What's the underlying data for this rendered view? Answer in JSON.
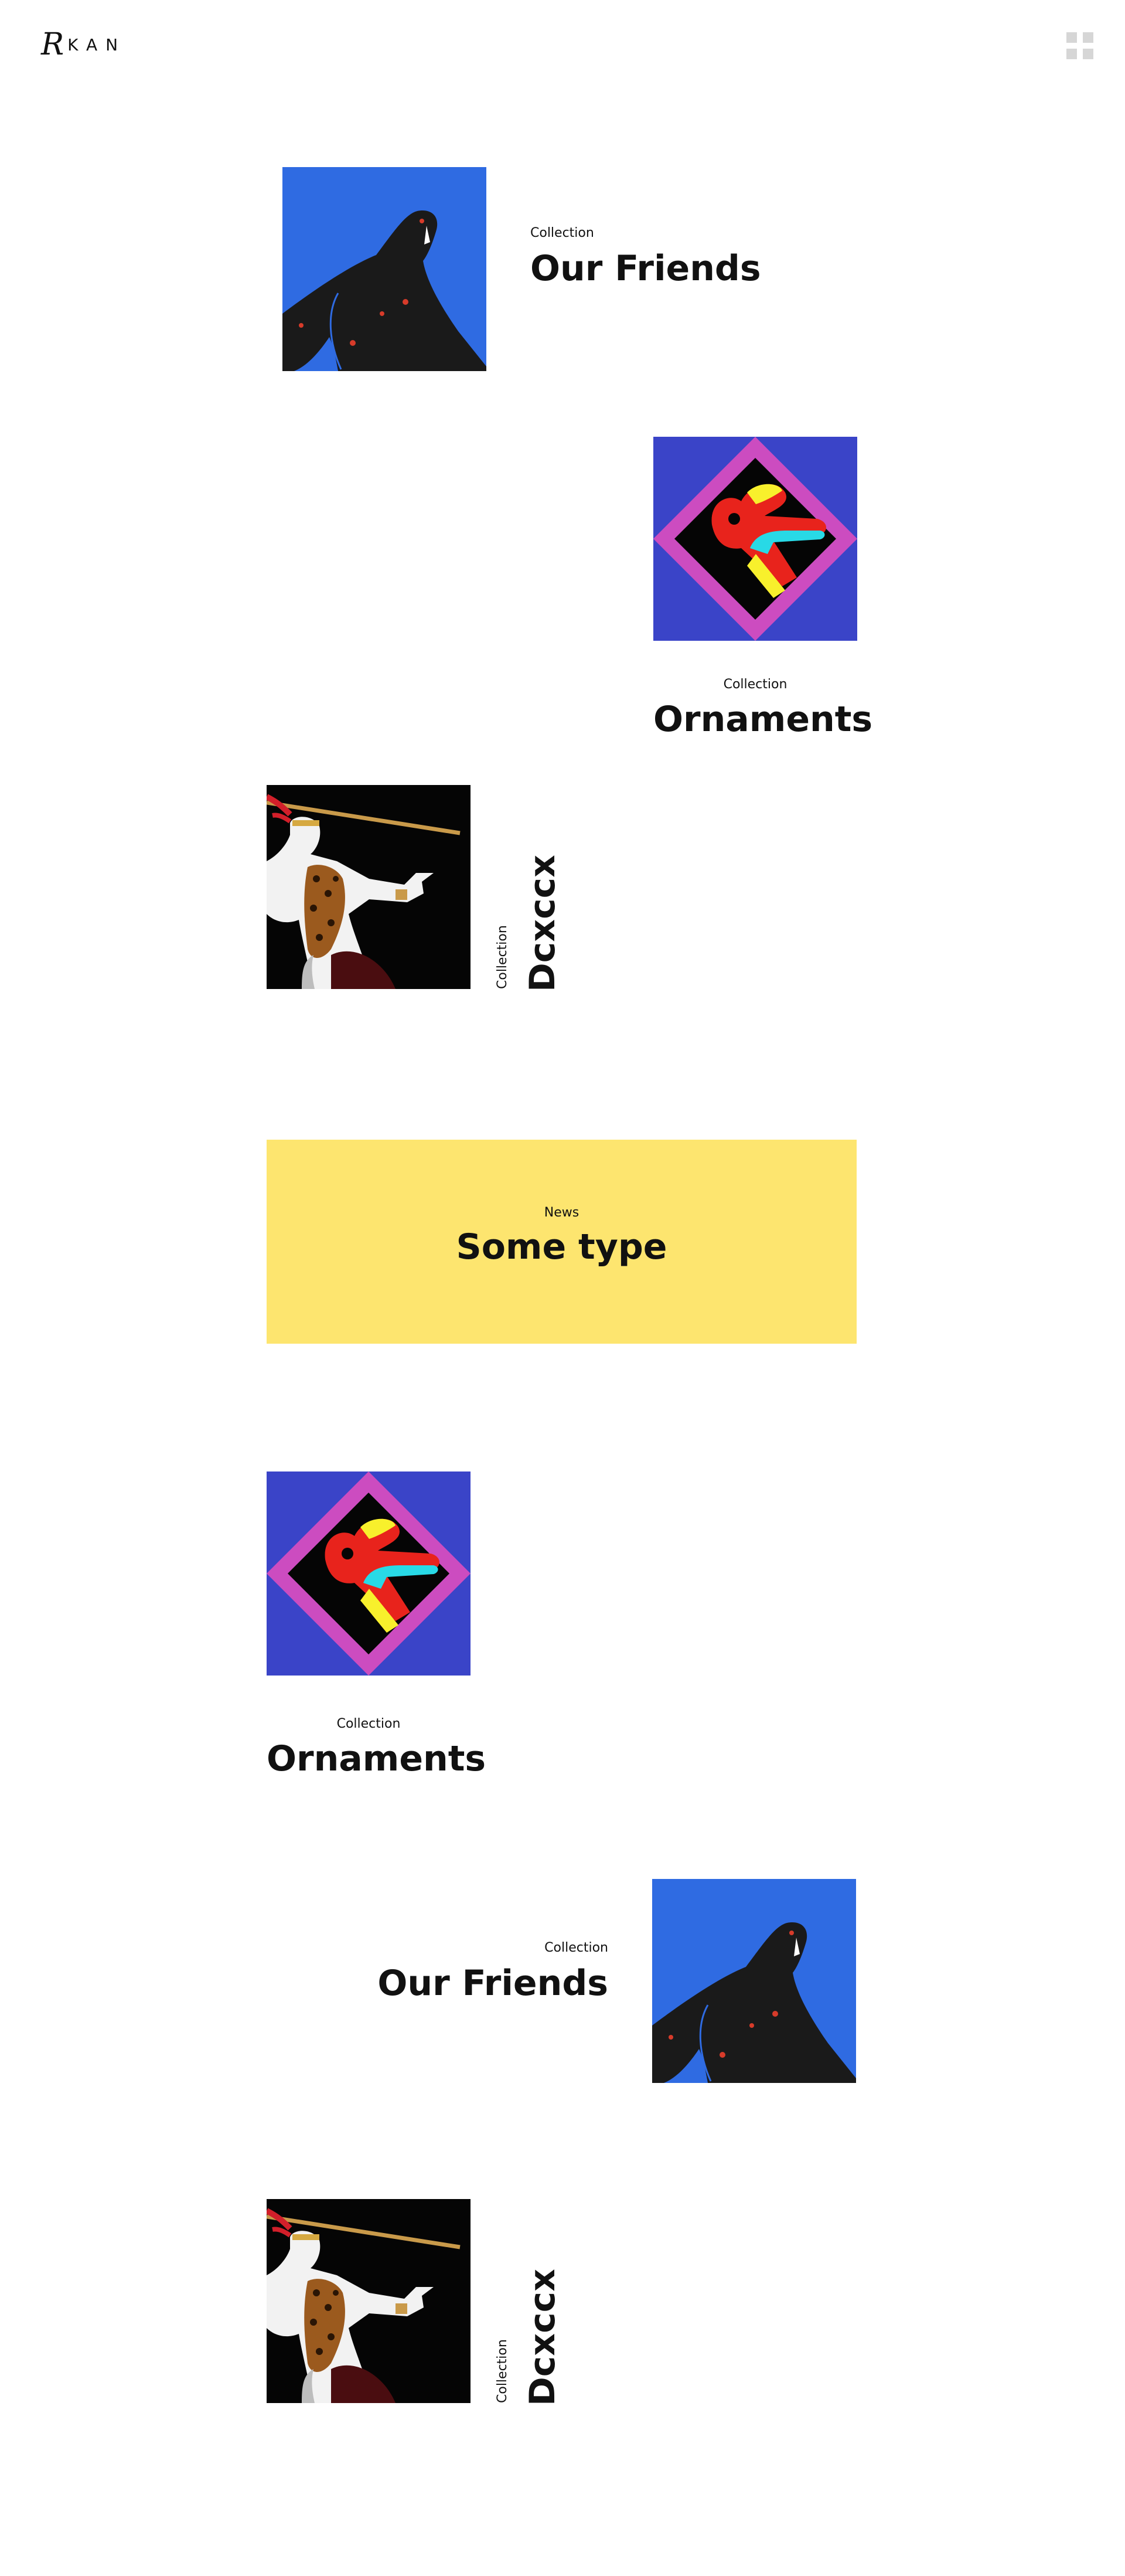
{
  "header": {
    "logo_initial": "R",
    "logo_word": "KAN",
    "menu_icon": "grid-menu-icon"
  },
  "items": [
    {
      "kicker": "Collection",
      "title": "Our Friends",
      "art": "blue-figure"
    },
    {
      "kicker": "Collection",
      "title": "Ornaments",
      "art": "ornament"
    },
    {
      "kicker": "Collection",
      "title": "Dcxccx",
      "art": "warrior"
    },
    {
      "kicker": "News",
      "title": "Some type"
    },
    {
      "kicker": "Collection",
      "title": "Ornaments",
      "art": "ornament"
    },
    {
      "kicker": "Collection",
      "title": "Our Friends",
      "art": "blue-figure"
    },
    {
      "kicker": "Collection",
      "title": "Dcxccx",
      "art": "warrior"
    }
  ],
  "colors": {
    "background": "#ffffff",
    "news_card": "#fde56f",
    "text": "#111111",
    "menu_icon": "#d6d6d6"
  }
}
